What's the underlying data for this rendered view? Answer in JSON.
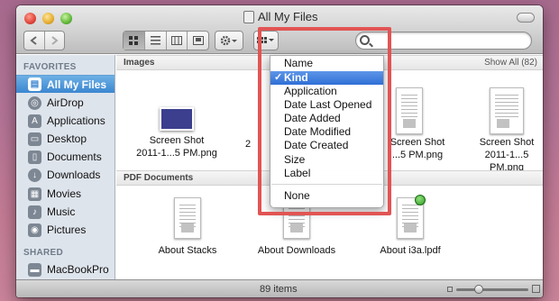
{
  "window": {
    "title": "All My Files"
  },
  "toolbar": {
    "view_modes": [
      "icon",
      "list",
      "column",
      "cover-flow"
    ],
    "active_view": "icon"
  },
  "sidebar": {
    "favorites_header": "FAVORITES",
    "items": [
      {
        "label": "All My Files",
        "icon": "all-files-icon",
        "selected": true
      },
      {
        "label": "AirDrop",
        "icon": "airdrop-icon"
      },
      {
        "label": "Applications",
        "icon": "applications-icon"
      },
      {
        "label": "Desktop",
        "icon": "desktop-icon"
      },
      {
        "label": "Documents",
        "icon": "documents-icon"
      },
      {
        "label": "Downloads",
        "icon": "downloads-icon"
      },
      {
        "label": "Movies",
        "icon": "movies-icon"
      },
      {
        "label": "Music",
        "icon": "music-icon"
      },
      {
        "label": "Pictures",
        "icon": "pictures-icon"
      }
    ],
    "shared_header": "SHARED",
    "shared_items": [
      {
        "label": "MacBookPro",
        "icon": "computer-icon"
      }
    ]
  },
  "content": {
    "images_header": "Images",
    "show_all": "Show All (82)",
    "images": [
      {
        "name_line1": "Screen Shot",
        "name_line2": "2011-1...5 PM.png"
      },
      {
        "name_line1": "",
        "name_line2": "2"
      },
      {
        "name_line1": "Screen Shot",
        "name_line2": "...5 PM.png"
      },
      {
        "name_line1": "Screen Shot",
        "name_line2": "2011-1...5 PM.png"
      }
    ],
    "pdf_header": "PDF Documents",
    "pdfs": [
      {
        "name": "About Stacks"
      },
      {
        "name": "About Downloads"
      },
      {
        "name": "About i3a.lpdf"
      }
    ]
  },
  "arrange_menu": {
    "items": [
      {
        "label": "Name"
      },
      {
        "label": "Kind",
        "selected": true,
        "checked": true
      },
      {
        "label": "Application"
      },
      {
        "label": "Date Last Opened"
      },
      {
        "label": "Date Added"
      },
      {
        "label": "Date Modified"
      },
      {
        "label": "Date Created"
      },
      {
        "label": "Size"
      },
      {
        "label": "Label"
      },
      {
        "label": "None"
      }
    ],
    "check_glyph": "✓"
  },
  "status": {
    "items_count": "89 items"
  },
  "colors": {
    "highlight": "#e25454",
    "selection": "#3b86d0"
  }
}
